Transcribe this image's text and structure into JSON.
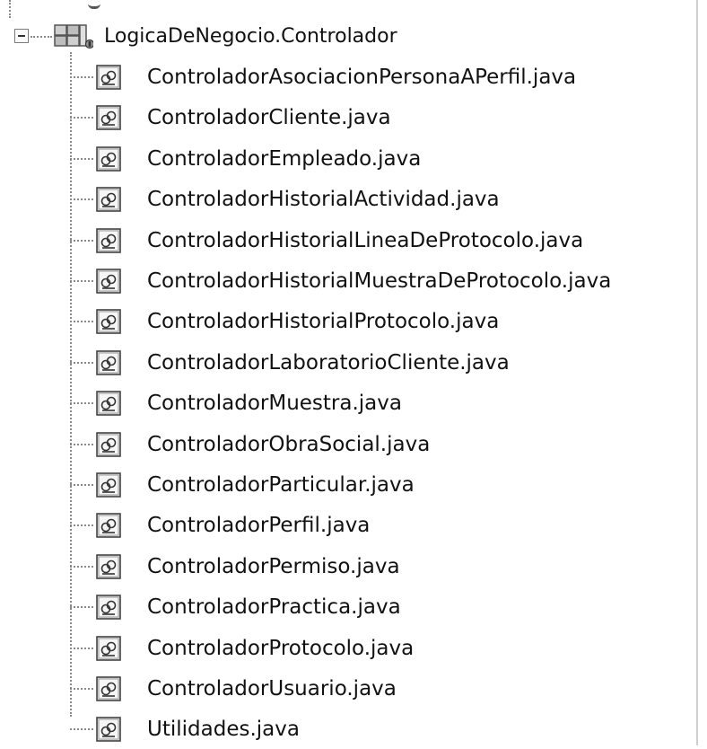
{
  "tree": {
    "package": {
      "label": "LogicaDeNegocio.Controlador",
      "expander": "minus",
      "icon": "package-icon"
    },
    "files": [
      "ControladorAsociacionPersonaAPerfil.java",
      "ControladorCliente.java",
      "ControladorEmpleado.java",
      "ControladorHistorialActividad.java",
      "ControladorHistorialLineaDeProtocolo.java",
      "ControladorHistorialMuestraDeProtocolo.java",
      "ControladorHistorialProtocolo.java",
      "ControladorLaboratorioCliente.java",
      "ControladorMuestra.java",
      "ControladorObraSocial.java",
      "ControladorParticular.java",
      "ControladorPerfil.java",
      "ControladorPermiso.java",
      "ControladorPractica.java",
      "ControladorProtocolo.java",
      "ControladorUsuario.java",
      "Utilidades.java"
    ],
    "file_icon": "java-file-icon"
  }
}
